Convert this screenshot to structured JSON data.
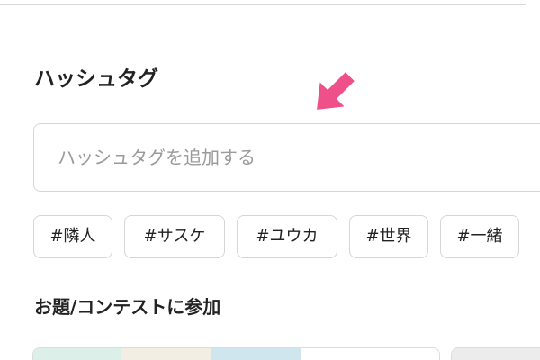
{
  "hashtag": {
    "title": "ハッシュタグ",
    "input_placeholder": "ハッシュタグを追加する",
    "suggestions": [
      "#隣人",
      "#サスケ",
      "#ユウカ",
      "#世界",
      "#一緒"
    ]
  },
  "contest": {
    "title": "お題/コンテストに参加"
  },
  "colors": {
    "arrow": "#f0508a",
    "border": "#d6d6d6",
    "placeholder": "#9a9a9a",
    "text": "#222222"
  },
  "icons": {
    "pointer_arrow": "arrow-pointing-down-left"
  }
}
